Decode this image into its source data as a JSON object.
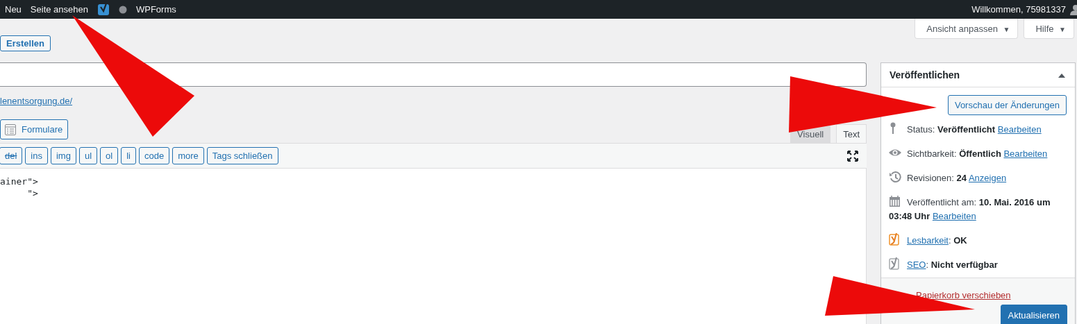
{
  "admin_bar": {
    "items": [
      "Neu",
      "Seite ansehen"
    ],
    "plugin": "WPForms",
    "welcome": "Willkommen, 75981337"
  },
  "screen_options": [
    "Ansicht anpassen",
    "Hilfe"
  ],
  "caret": "▼",
  "create_button": "Erstellen",
  "permalink": "lenentsorgung.de/",
  "forms_button": "Formulare",
  "editor_tabs": [
    {
      "label": "Visuell",
      "selected": false
    },
    {
      "label": "Text",
      "selected": true
    }
  ],
  "quicktags": [
    {
      "label": "del",
      "struck": true
    },
    {
      "label": "ins",
      "struck": false
    },
    {
      "label": "img",
      "struck": false
    },
    {
      "label": "ul",
      "struck": false
    },
    {
      "label": "ol",
      "struck": false
    },
    {
      "label": "li",
      "struck": false
    },
    {
      "label": "code",
      "struck": false
    },
    {
      "label": "more",
      "struck": false
    },
    {
      "label": "Tags schließen",
      "struck": false
    }
  ],
  "code_lines": [
    "ainer\">",
    "     \">"
  ],
  "publish": {
    "title": "Veröffentlichen",
    "preview_button": "Vorschau der Änderungen",
    "rows": [
      {
        "kind": "status",
        "text": "Status: **Veröffentlicht**",
        "link": "Bearbeiten"
      },
      {
        "kind": "visibility",
        "text": "Sichtbarkeit: **Öffentlich**",
        "link": "Bearbeiten"
      },
      {
        "kind": "revisions",
        "text": "Revisionen: **24**",
        "link": "Anzeigen"
      },
      {
        "kind": "date",
        "text": "Veröffentlicht am: **10. Mai. 2016 um 03:48 Uhr**",
        "link": "Bearbeiten"
      },
      {
        "kind": "readability",
        "text": ": **OK**",
        "link": "Lesbarkeit"
      },
      {
        "kind": "seo",
        "text": ": **Nicht verfügbar**",
        "link": "SEO"
      }
    ],
    "trash_link": "Papierkorb verschieben",
    "update_button": "Aktualisieren"
  }
}
